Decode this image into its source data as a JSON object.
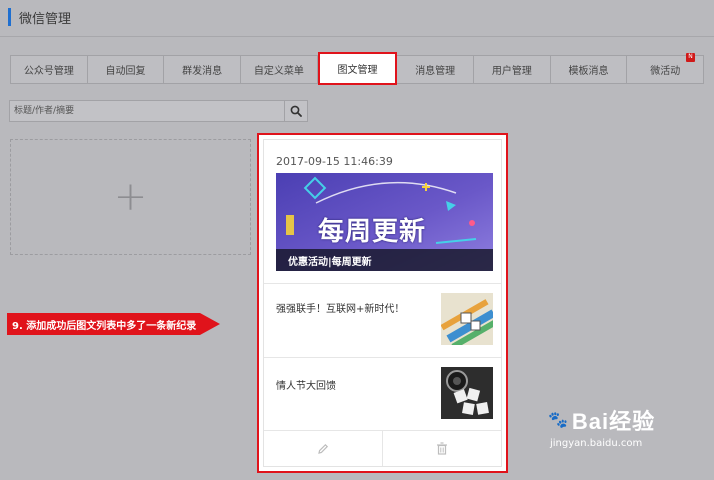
{
  "header": {
    "title": "微信管理"
  },
  "tabs": [
    {
      "label": "公众号管理"
    },
    {
      "label": "自动回复"
    },
    {
      "label": "群发消息"
    },
    {
      "label": "自定义菜单"
    },
    {
      "label": "图文管理",
      "active": true
    },
    {
      "label": "消息管理"
    },
    {
      "label": "用户管理"
    },
    {
      "label": "模板消息"
    },
    {
      "label": "微活动",
      "badge": "N"
    }
  ],
  "search": {
    "placeholder": "标题/作者/摘要",
    "icon": "search-icon"
  },
  "add_card": {
    "symbol": "+"
  },
  "article": {
    "date": "2017-09-15 11:46:39",
    "cover_caption": "优惠活动|每周更新",
    "cover_text": "每周更新",
    "items": [
      {
        "title": "强强联手！互联网+新时代！"
      },
      {
        "title": "情人节大回馈"
      }
    ]
  },
  "annotation": {
    "text": "9. 添加成功后图文列表中多了一条新纪录"
  },
  "watermark": {
    "logo": "Bai经验",
    "url": "jingyan.baidu.com"
  },
  "colors": {
    "accent_red": "#e0131b",
    "brand_blue": "#1f6fd0",
    "overlay": "#b9b9bd"
  }
}
